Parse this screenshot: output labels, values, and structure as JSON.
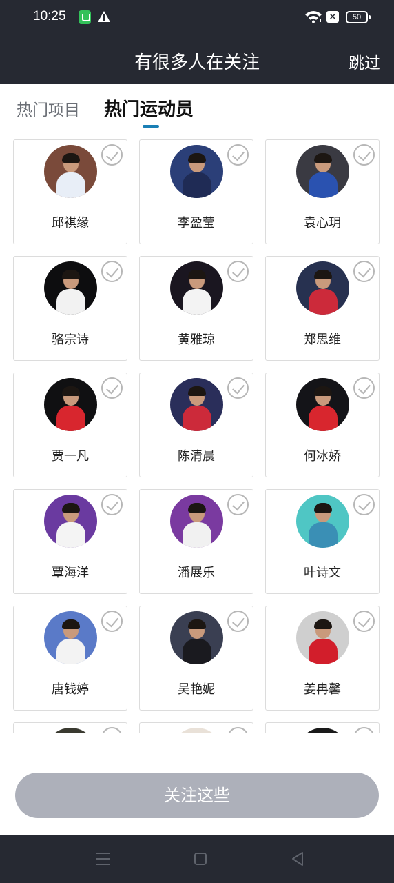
{
  "status_bar": {
    "time": "10:25",
    "battery": "50",
    "icons": [
      "app-notification-icon",
      "warning-icon",
      "wifi-icon",
      "close-box-icon",
      "battery-icon"
    ]
  },
  "header": {
    "title": "有很多人在关注",
    "skip_label": "跳过"
  },
  "tabs": [
    {
      "label": "热门项目",
      "active": false
    },
    {
      "label": "热门运动员",
      "active": true
    }
  ],
  "athletes": [
    {
      "name": "邱祺缘",
      "bg": "#7a4a3a",
      "uniform": "#e8eef7"
    },
    {
      "name": "李盈莹",
      "bg": "#2b3f78",
      "uniform": "#1f2b55"
    },
    {
      "name": "袁心玥",
      "bg": "#3a3a42",
      "uniform": "#2a52b0"
    },
    {
      "name": "骆宗诗",
      "bg": "#0d0d0f",
      "uniform": "#f2f2f2"
    },
    {
      "name": "黄雅琼",
      "bg": "#1a1620",
      "uniform": "#f3f3f3"
    },
    {
      "name": "郑思维",
      "bg": "#273150",
      "uniform": "#cc2a3a"
    },
    {
      "name": "贾一凡",
      "bg": "#101012",
      "uniform": "#d8262e"
    },
    {
      "name": "陈清晨",
      "bg": "#2a2e5a",
      "uniform": "#cc2a3a"
    },
    {
      "name": "何冰娇",
      "bg": "#141418",
      "uniform": "#d8262e"
    },
    {
      "name": "覃海洋",
      "bg": "#6a3aa0",
      "uniform": "#f4f4f4"
    },
    {
      "name": "潘展乐",
      "bg": "#7a3aa0",
      "uniform": "#f1f1f1"
    },
    {
      "name": "叶诗文",
      "bg": "#4fc6c4",
      "uniform": "#3a8fb5"
    },
    {
      "name": "唐钱婷",
      "bg": "#5a7ac8",
      "uniform": "#f3f3f3"
    },
    {
      "name": "吴艳妮",
      "bg": "#3a3f52",
      "uniform": "#1a1a1f"
    },
    {
      "name": "姜冉馨",
      "bg": "#cfcfcf",
      "uniform": "#d21e2b"
    },
    {
      "name": "",
      "bg": "#3a3a30",
      "uniform": "#3a3a30"
    },
    {
      "name": "",
      "bg": "#e9e1d8",
      "uniform": "#e9e1d8"
    },
    {
      "name": "",
      "bg": "#1a1a1a",
      "uniform": "#1a1a1a"
    }
  ],
  "follow_button_label": "关注这些",
  "colors": {
    "header_bg": "#262932",
    "tab_indicator": "#1a7fb5",
    "button_disabled": "#adb0ba"
  }
}
